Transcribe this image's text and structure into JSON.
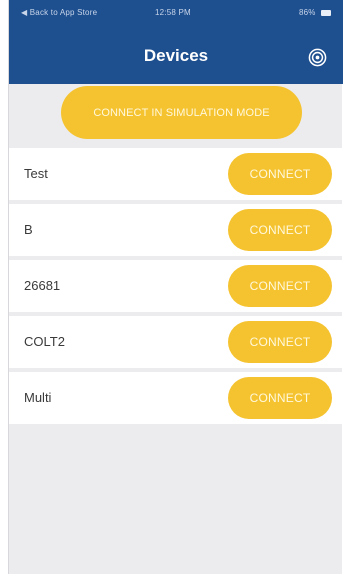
{
  "status_bar": {
    "back_text": "◀ Back to App Store",
    "time": "12:58 PM",
    "battery": "86%"
  },
  "nav": {
    "title": "Devices",
    "right_icon": "settings-target-icon"
  },
  "simulation_button": {
    "label": "CONNECT IN SIMULATION MODE"
  },
  "devices": [
    {
      "name": "Test",
      "button_label": "CONNECT"
    },
    {
      "name": "B",
      "button_label": "CONNECT"
    },
    {
      "name": "26681",
      "button_label": "CONNECT"
    },
    {
      "name": "COLT2",
      "button_label": "CONNECT"
    },
    {
      "name": "Multi",
      "button_label": "CONNECT"
    }
  ],
  "colors": {
    "header": "#1e4f8f",
    "accent": "#f5c330",
    "background": "#ececee"
  }
}
